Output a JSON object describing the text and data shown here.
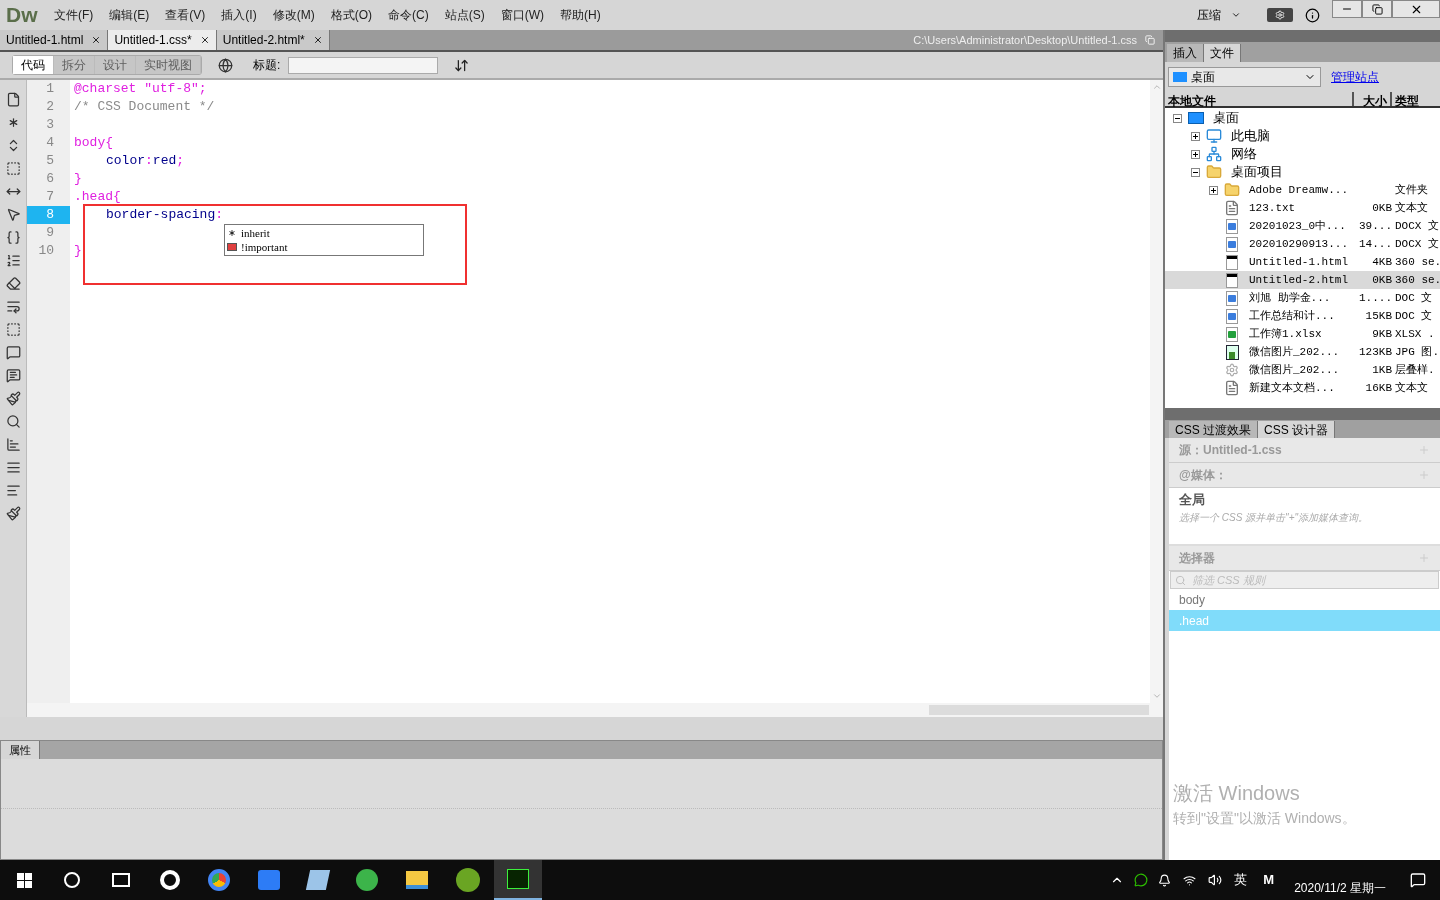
{
  "app": {
    "logo": "Dw",
    "menu": [
      "文件(F)",
      "编辑(E)",
      "查看(V)",
      "插入(I)",
      "修改(M)",
      "格式(O)",
      "命令(C)",
      "站点(S)",
      "窗口(W)",
      "帮助(H)"
    ],
    "compress": "压缩"
  },
  "doc_tabs": [
    {
      "label": "Untitled-1.html",
      "selected": false
    },
    {
      "label": "Untitled-1.css*",
      "selected": true
    },
    {
      "label": "Untitled-2.html*",
      "selected": false
    }
  ],
  "file_path": "C:\\Users\\Administrator\\Desktop\\Untitled-1.css",
  "toolbar": {
    "views": [
      {
        "label": "代码",
        "selected": true
      },
      {
        "label": "拆分",
        "selected": false
      },
      {
        "label": "设计",
        "selected": false
      },
      {
        "label": "实时视图",
        "selected": false
      }
    ],
    "title_label": "标题:"
  },
  "code_lines": [
    {
      "number": "1",
      "current": false,
      "indented": false,
      "segments": [
        {
          "text": "@charset \"utf-8\";",
          "kind": "at"
        }
      ]
    },
    {
      "number": "2",
      "current": false,
      "indented": false,
      "segments": [
        {
          "text": "/* CSS Document */",
          "kind": "comment"
        }
      ]
    },
    {
      "number": "3",
      "current": false
    },
    {
      "number": "4",
      "current": false,
      "indented": false,
      "segments": [
        {
          "text": "body{",
          "kind": "selector"
        }
      ]
    },
    {
      "number": "5",
      "current": false,
      "indented": true,
      "segments": [
        {
          "text": "color",
          "kind": "property"
        },
        {
          "text": ":",
          "kind": "punct"
        },
        {
          "text": "red",
          "kind": "property"
        },
        {
          "text": ";",
          "kind": "punct"
        }
      ]
    },
    {
      "number": "6",
      "current": false,
      "indented": false,
      "segments": [
        {
          "text": "}",
          "kind": "selector"
        }
      ]
    },
    {
      "number": "7",
      "current": false,
      "indented": false,
      "segments": [
        {
          "text": ".head{",
          "kind": "selector"
        }
      ]
    },
    {
      "number": "8",
      "current": true,
      "indented": true,
      "segments": [
        {
          "text": "border-spacing",
          "kind": "property"
        },
        {
          "text": ":",
          "kind": "punct"
        }
      ]
    },
    {
      "number": "9",
      "current": false
    },
    {
      "number": "10",
      "current": false,
      "indented": false,
      "segments": [
        {
          "text": "}",
          "kind": "selector"
        }
      ]
    }
  ],
  "autocomplete": [
    {
      "label": "inherit",
      "kind": "keyword"
    },
    {
      "label": "!important",
      "kind": "flag"
    }
  ],
  "properties_panel": {
    "title": "属性"
  },
  "right_panel": {
    "tabs": [
      {
        "label": "插入",
        "selected": false
      },
      {
        "label": "文件",
        "selected": true
      }
    ],
    "site": "桌面",
    "manage_link": "管理站点",
    "columns": [
      "本地文件",
      "大小",
      "类型"
    ],
    "tree": [
      {
        "name": "桌面",
        "kind": "desktop",
        "expanded": true,
        "children": [
          {
            "name": "此电脑",
            "kind": "computer",
            "expanded": false
          },
          {
            "name": "网络",
            "kind": "network",
            "expanded": false
          },
          {
            "name": "桌面项目",
            "kind": "folder",
            "expanded": true,
            "children": [
              {
                "name": "Adobe Dreamw...",
                "kind": "folder",
                "expanded": false,
                "type": "文件夹",
                "selected": false
              },
              {
                "name": "123.txt",
                "kind": "text",
                "size": "0KB",
                "type": "文本文",
                "selected": false
              },
              {
                "name": "20201023_0中...",
                "kind": "word",
                "size": "39...",
                "type": "DOCX 文",
                "selected": false
              },
              {
                "name": "202010290913...",
                "kind": "word",
                "size": "14...",
                "type": "DOCX 文",
                "selected": false
              },
              {
                "name": "Untitled-1.html",
                "kind": "html",
                "size": "4KB",
                "type": "360 se.",
                "selected": false
              },
              {
                "name": "Untitled-2.html",
                "kind": "html",
                "size": "0KB",
                "type": "360 se.",
                "selected": true
              },
              {
                "name": "刘旭 助学金...",
                "kind": "word",
                "size": "1....",
                "type": "DOC 文",
                "selected": false
              },
              {
                "name": "工作总结和计...",
                "kind": "word",
                "size": "15KB",
                "type": "DOC 文",
                "selected": false
              },
              {
                "name": "工作簿1.xlsx",
                "kind": "sheet",
                "size": "9KB",
                "type": "XLSX .",
                "selected": false
              },
              {
                "name": "微信图片_202...",
                "kind": "image",
                "size": "123KB",
                "type": "JPG 图.",
                "selected": false
              },
              {
                "name": "微信图片_202...",
                "kind": "gear",
                "size": "1KB",
                "type": "层叠样.",
                "selected": false
              },
              {
                "name": "新建文本文档...",
                "kind": "text",
                "size": "16KB",
                "type": "文本文",
                "selected": false
              }
            ]
          }
        ]
      }
    ]
  },
  "css_panel": {
    "tabs": [
      {
        "label": "CSS 过渡效果",
        "selected": false
      },
      {
        "label": "CSS 设计器",
        "selected": true
      }
    ],
    "source": "源：Untitled-1.css",
    "media_header": "@媒体：",
    "media_global": "全局",
    "media_hint": "选择一个 CSS 源并单击\"+\"添加媒体查询。",
    "selectors_header": "选择器",
    "filter_placeholder": "筛选 CSS 规则",
    "selectors": [
      {
        "label": "body",
        "selected": false
      },
      {
        "label": ".head",
        "selected": true
      }
    ]
  },
  "activation": {
    "title": "激活 Windows",
    "hint": "转到\"设置\"以激活 Windows。"
  },
  "taskbar": {
    "ime": "英",
    "ime_mode": "M",
    "date": "2020/11/2 星期一"
  }
}
